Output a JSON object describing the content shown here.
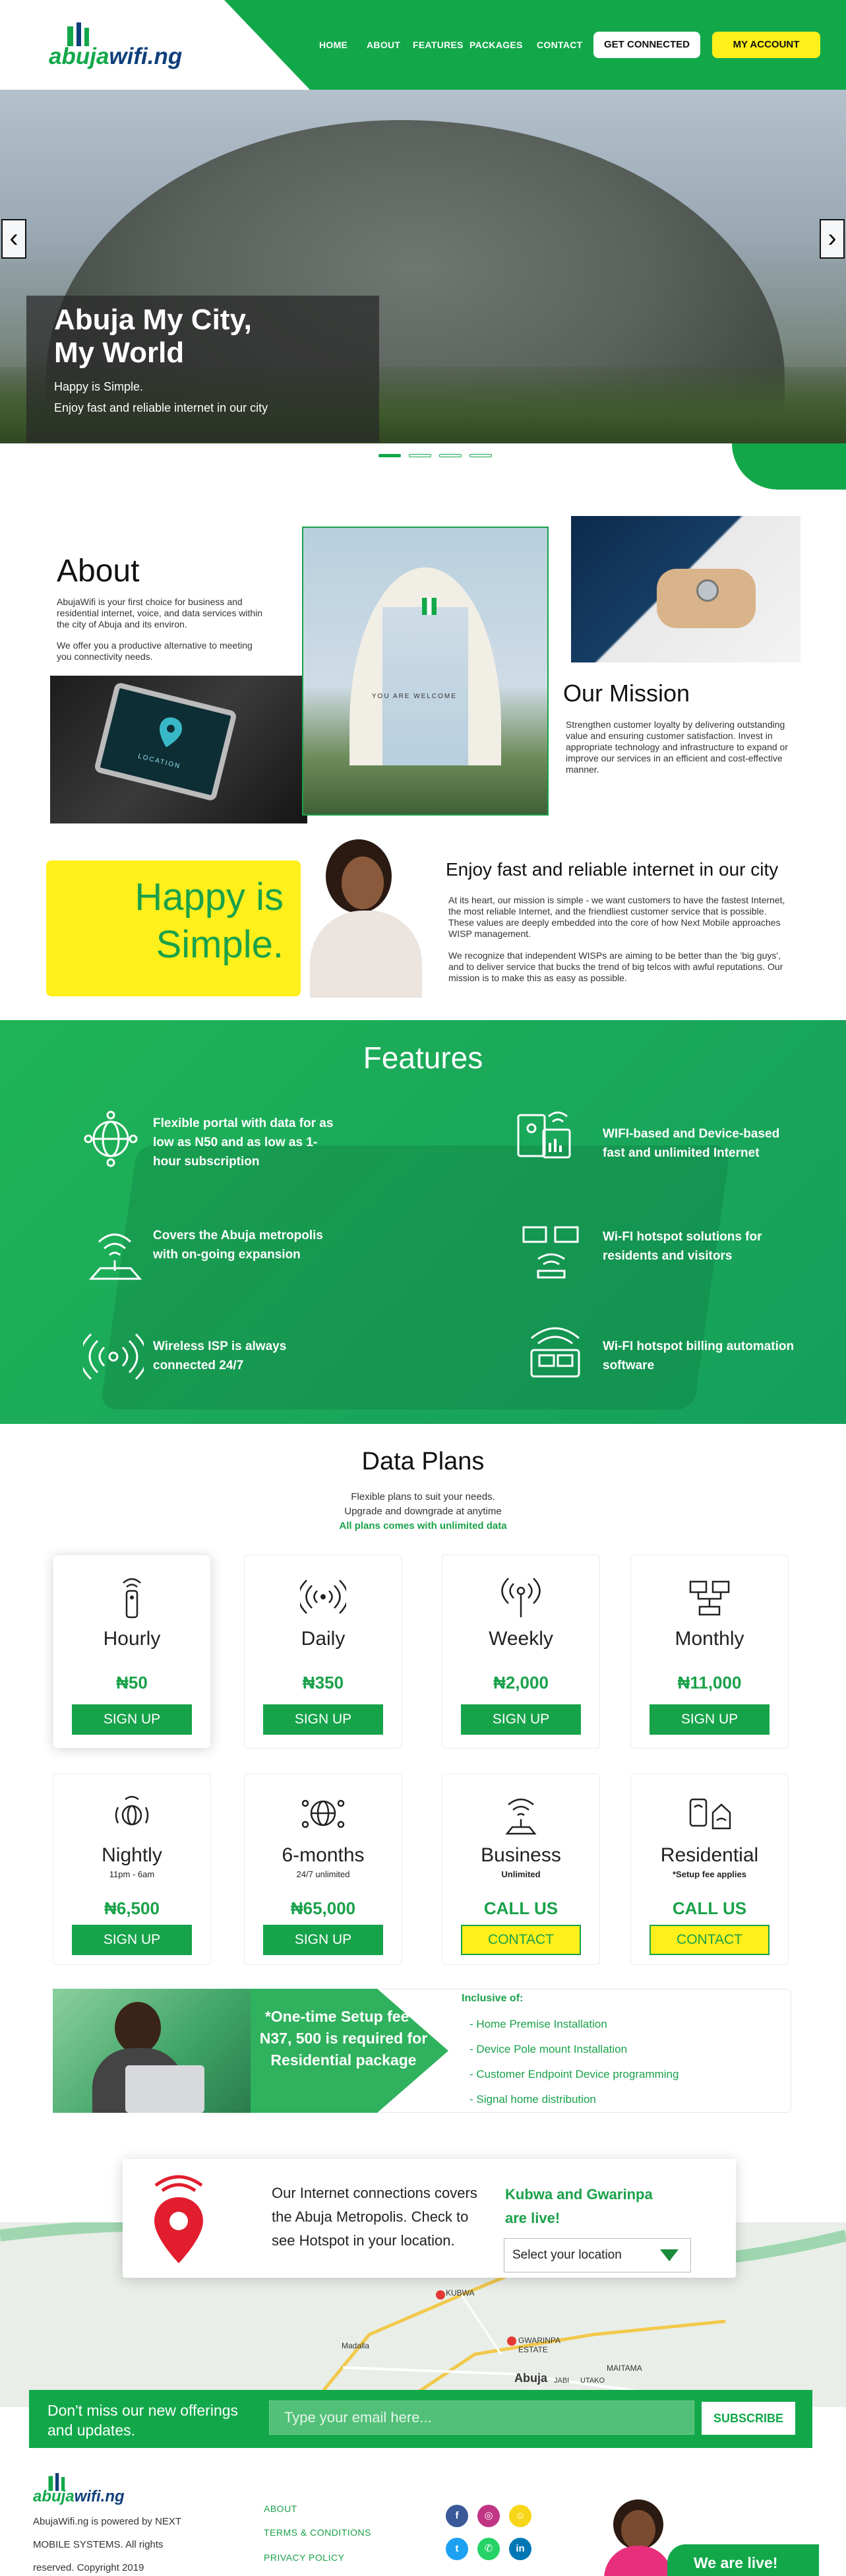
{
  "brand": {
    "logo_a": "abuja",
    "logo_b": "wifi.ng"
  },
  "nav": {
    "items": [
      "HOME",
      "ABOUT",
      "FEATURES",
      "PACKAGES",
      "CONTACT"
    ],
    "get_connected": "GET CONNECTED",
    "my_account": "MY ACCOUNT"
  },
  "hero": {
    "title_line1": "Abuja My City,",
    "title_line2": "My World",
    "sub1": "Happy is Simple.",
    "sub2": "Enjoy fast and reliable internet in our city",
    "slides": 4,
    "active_slide": 1
  },
  "about": {
    "title": "About",
    "p1": "AbujaWifi is your first choice for business and residential internet, voice, and data services within the city of Abuja and its environ.",
    "p2": "We offer you a productive alternative to meeting you connectivity needs.",
    "gate_text": "YOU ARE WELCOME",
    "tablet_text": "LOCATION"
  },
  "mission": {
    "title": "Our Mission",
    "text": "Strengthen customer loyalty by delivering outstanding value and ensuring customer satisfaction. Invest in appropriate technology and infrastructure to expand or improve our services in an efficient and cost-effective manner."
  },
  "happy": {
    "line1": "Happy is",
    "line2": "Simple.",
    "title": "Enjoy fast and reliable internet in our city",
    "p1": "At its heart, our mission is simple - we want customers to have the fastest Internet, the most reliable Internet, and the friendliest customer service that is possible. These values are deeply embedded into the core of how Next Mobile approaches WISP management.",
    "p2": "We recognize that independent WISPs are aiming to be better than the 'big guys', and to deliver service that bucks the trend of big telcos with awful reputations. Our mission is to make this as easy as possible."
  },
  "features": {
    "title": "Features",
    "items": [
      {
        "text": "Flexible portal  with data for as low as N50 and as low as 1-hour subscription",
        "icon": "globe-icon"
      },
      {
        "text": "WIFI-based and Device-based fast and unlimited Internet",
        "icon": "devices-icon"
      },
      {
        "text": "Covers the Abuja metropolis with on-going expansion",
        "icon": "wifi-map-icon"
      },
      {
        "text": "Wi-FI hotspot solutions for residents and visitors",
        "icon": "router-icon"
      },
      {
        "text": "Wireless ISP is always connected 24/7",
        "icon": "signal-icon"
      },
      {
        "text": "Wi-FI hotspot billing automation software",
        "icon": "billing-icon"
      }
    ]
  },
  "plans": {
    "title": "Data Plans",
    "sub1": "Flexible plans to suit your needs.",
    "sub2": "Upgrade and downgrade at anytime",
    "sub3": "All plans comes with unlimited data",
    "items": [
      {
        "name": "Hourly",
        "price": "₦50",
        "button": "SIGN UP",
        "note": ""
      },
      {
        "name": "Daily",
        "price": "₦350",
        "button": "SIGN UP",
        "note": ""
      },
      {
        "name": "Weekly",
        "price": "₦2,000",
        "button": "SIGN UP",
        "note": ""
      },
      {
        "name": "Monthly",
        "price": "₦11,000",
        "button": "SIGN UP",
        "note": ""
      },
      {
        "name": "Nightly",
        "price": "₦6,500",
        "button": "SIGN UP",
        "note": "11pm - 6am"
      },
      {
        "name": "6-months",
        "price": "₦65,000",
        "button": "SIGN UP",
        "note": "24/7 unlimited"
      },
      {
        "name": "Business",
        "price": "CALL US",
        "button": "CONTACT",
        "note": "Unlimited"
      },
      {
        "name": "Residential",
        "price": "CALL US",
        "button": "CONTACT",
        "note": "*Setup fee applies"
      }
    ]
  },
  "setup": {
    "text": "*One-time Setup fee = N37, 500 is required for Residential package",
    "incl_title": "Inclusive of:",
    "items": [
      "- Home Premise Installation",
      "- Device Pole mount Installation",
      "- Customer Endpoint Device programming",
      "- Signal home distribution"
    ]
  },
  "coverage": {
    "text": "Our Internet connections covers the Abuja Metropolis. Check to see Hotspot in your location.",
    "live": "Kubwa and Gwarinpa are live!",
    "select": "Select your location",
    "map_labels": [
      "KUBWA",
      "GWARINPA ESTATE",
      "Abuja",
      "Madalla",
      "MAITAMA",
      "JABI",
      "UTAKO"
    ]
  },
  "newsletter": {
    "text": "Don't miss our new offerings and updates.",
    "placeholder": "Type your email here...",
    "button": "SUBSCRIBE"
  },
  "footer": {
    "text": "AbujaWifi.ng is powered by NEXT MOBILE SYSTEMS. All rights reserved. Copyright 2019",
    "links": [
      "ABOUT",
      "TERMS & CONDITIONS",
      "PRIVACY POLICY"
    ],
    "live": "We are live!"
  },
  "colors": {
    "green": "#12a84a",
    "yellow": "#ffef1a",
    "navy": "#0f3f7a"
  }
}
